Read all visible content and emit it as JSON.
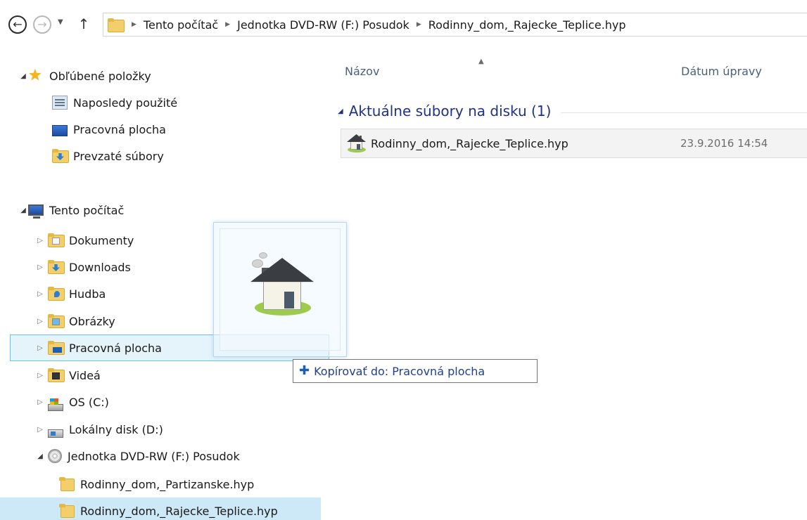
{
  "address_bar": {
    "breadcrumbs": [
      "Tento počítač",
      "Jednotka DVD-RW (F:) Posudok",
      "Rodinny_dom,_Rajecke_Teplice.hyp"
    ]
  },
  "nav_pane": {
    "favorites": {
      "label": "Obľúbené položky",
      "items": [
        {
          "label": "Naposledy použité",
          "icon": "recent-places-icon"
        },
        {
          "label": "Pracovná plocha",
          "icon": "desktop-icon"
        },
        {
          "label": "Prevzaté súbory",
          "icon": "downloads-folder-icon"
        }
      ]
    },
    "this_pc": {
      "label": "Tento počítač",
      "items": [
        {
          "label": "Dokumenty"
        },
        {
          "label": "Downloads"
        },
        {
          "label": "Hudba"
        },
        {
          "label": "Obrázky"
        },
        {
          "label": "Pracovná plocha"
        },
        {
          "label": "Videá"
        },
        {
          "label": "OS (C:)"
        },
        {
          "label": "Lokálny disk (D:)"
        },
        {
          "label": "Jednotka DVD-RW (F:) Posudok"
        }
      ]
    },
    "dvd_children": [
      {
        "label": "Rodinny_dom,_Partizanske.hyp"
      },
      {
        "label": "Rodinny_dom,_Rajecke_Teplice.hyp"
      }
    ]
  },
  "content": {
    "columns": {
      "name": "Názov",
      "date": "Dátum úpravy"
    },
    "group": {
      "label": "Aktuálne súbory na disku (1)"
    },
    "files": [
      {
        "name": "Rodinny_dom,_Rajecke_Teplice.hyp",
        "date": "23.9.2016 14:54"
      }
    ]
  },
  "drag": {
    "tooltip": "Kopírovať do: Pracovná plocha"
  }
}
